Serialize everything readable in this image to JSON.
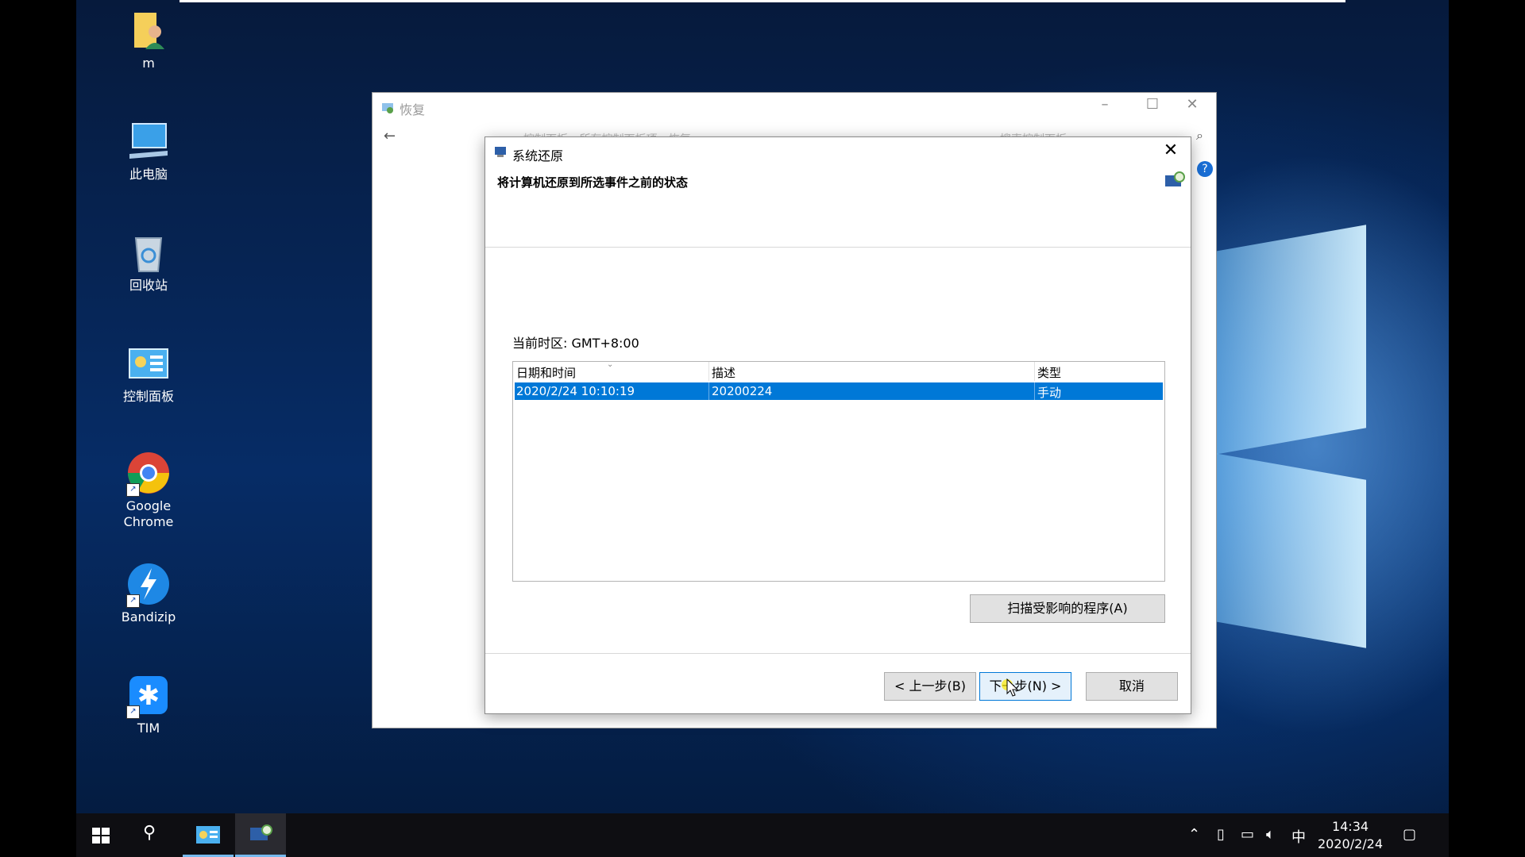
{
  "desktop": {
    "icons": [
      {
        "label": "m"
      },
      {
        "label": "此电脑"
      },
      {
        "label": "回收站"
      },
      {
        "label": "控制面板"
      },
      {
        "label": "Google Chrome"
      },
      {
        "label": "Bandizip"
      },
      {
        "label": "TIM"
      }
    ]
  },
  "recovery_window": {
    "title": "恢复",
    "address_text": "控制面板 › 所有控制面板项 › 恢复",
    "search_placeholder": "搜索控制面板"
  },
  "dialog": {
    "title": "系统还原",
    "heading": "将计算机还原到所选事件之前的状态",
    "timezone": "当前时区: GMT+8:00",
    "columns": [
      "日期和时间",
      "描述",
      "类型"
    ],
    "rows": [
      {
        "datetime": "2020/2/24 10:10:19",
        "description": "20200224",
        "type": "手动",
        "selected": true
      }
    ],
    "scan_button": "扫描受影响的程序(A)",
    "back_button": "< 上一步(B)",
    "next_button": "下一步(N) >",
    "cancel_button": "取消"
  },
  "taskbar": {
    "ime": "中",
    "time": "14:34",
    "date": "2020/2/24"
  },
  "colors": {
    "selection": "#0078d7",
    "taskbar": "#0e0e12"
  }
}
